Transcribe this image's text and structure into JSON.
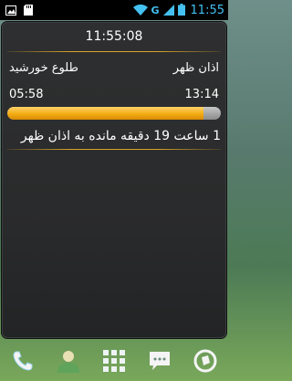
{
  "status_bar": {
    "time": "11:55",
    "network_letter": "G",
    "icons": [
      "image-icon",
      "sd-card-icon",
      "wifi-icon",
      "signal-icon",
      "battery-icon"
    ]
  },
  "widget": {
    "clock": "11:55:08",
    "prayer_name": "اذان ظهر",
    "sunrise_label": "طلوع خورشید",
    "prayer_time": "13:14",
    "sunrise_time": "05:58",
    "progress_percent": 92,
    "remaining_text": "1 ساعت 19 دقیقه مانده به اذان ظهر"
  },
  "dock": {
    "items": [
      "phone-icon",
      "contacts-icon",
      "app-drawer-icon",
      "messaging-icon",
      "browser-icon"
    ]
  },
  "colors": {
    "accent": "#44c1f1",
    "progress": "#f2ac12",
    "divider": "#d9a42a"
  }
}
